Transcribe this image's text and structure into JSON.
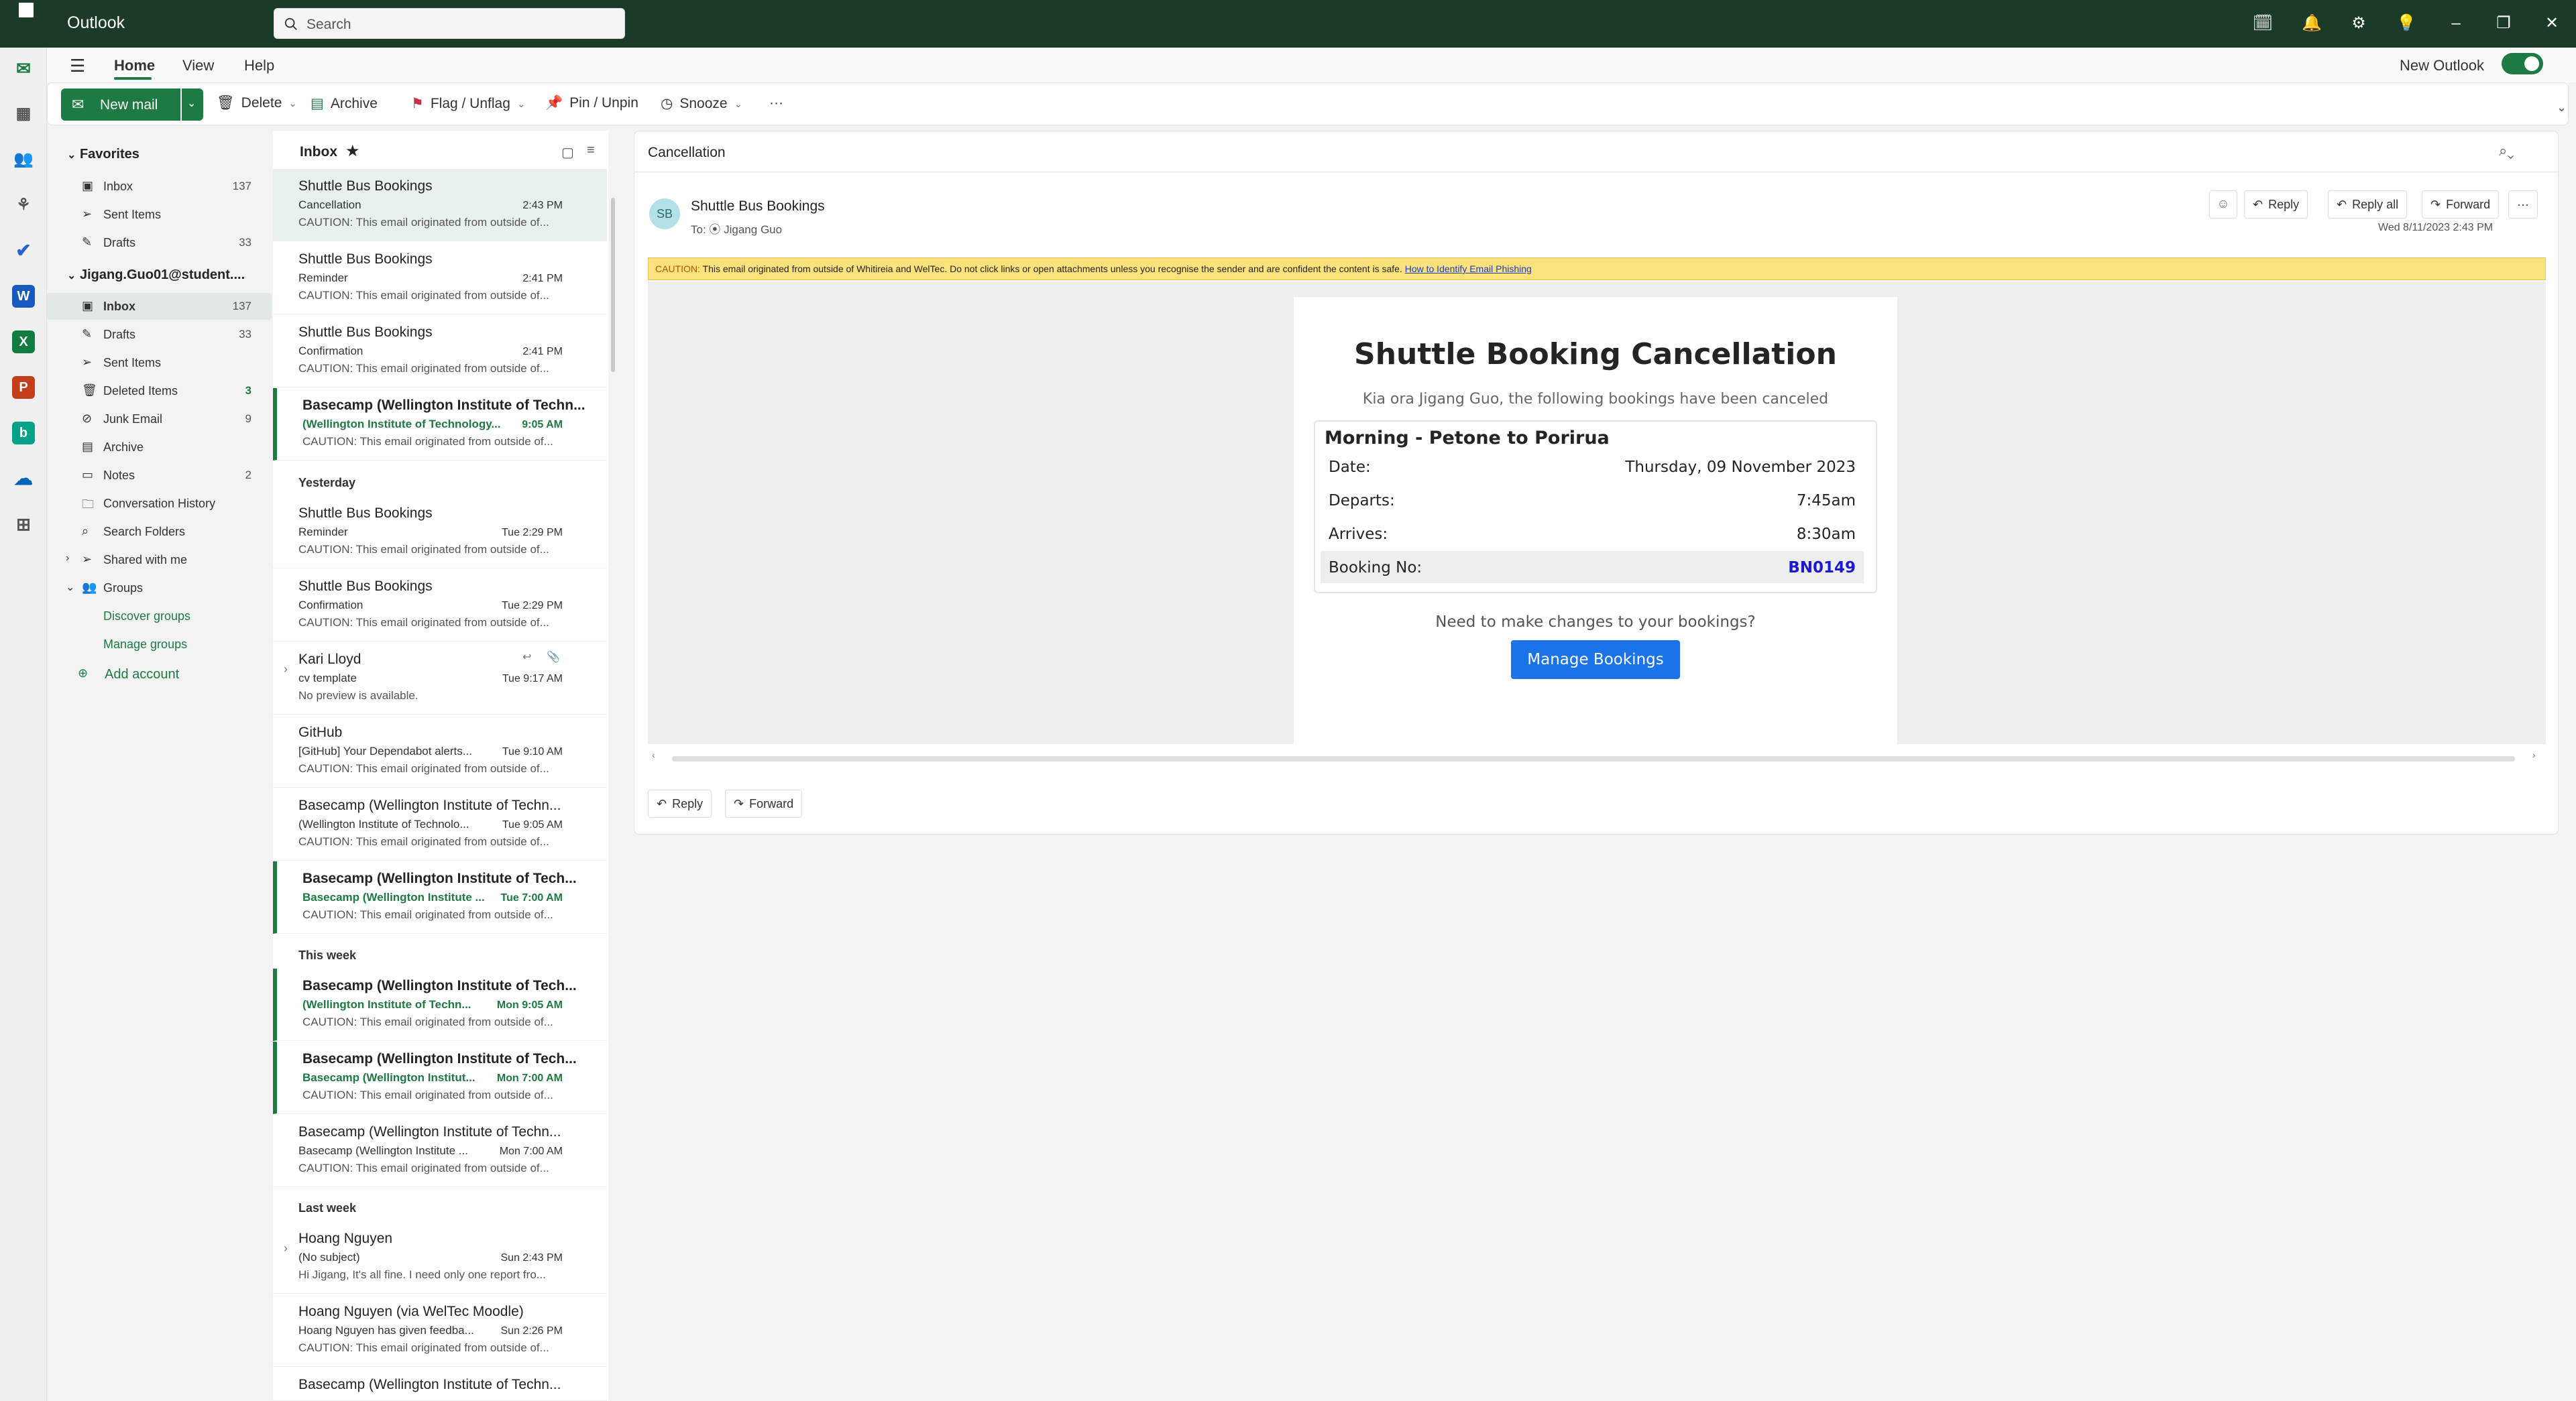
{
  "app": {
    "title": "Outlook",
    "new_outlook_label": "New Outlook"
  },
  "search": {
    "placeholder": "Search"
  },
  "menu": {
    "items": [
      "Home",
      "View",
      "Help"
    ]
  },
  "ribbon": {
    "new_mail": "New mail",
    "delete": "Delete",
    "archive": "Archive",
    "flag": "Flag / Unflag",
    "pin": "Pin / Unpin",
    "snooze": "Snooze",
    "more": "···"
  },
  "folders": {
    "favorites_label": "Favorites",
    "favorites": [
      {
        "name": "Inbox",
        "count": "137"
      },
      {
        "name": "Sent Items",
        "count": ""
      },
      {
        "name": "Drafts",
        "count": "33"
      }
    ],
    "account_label": "Jigang.Guo01@student....",
    "account_items": [
      {
        "name": "Inbox",
        "count": "137"
      },
      {
        "name": "Drafts",
        "count": "33"
      },
      {
        "name": "Sent Items",
        "count": ""
      },
      {
        "name": "Deleted Items",
        "count": "3"
      },
      {
        "name": "Junk Email",
        "count": "9"
      },
      {
        "name": "Archive",
        "count": ""
      },
      {
        "name": "Notes",
        "count": "2"
      },
      {
        "name": "Conversation History",
        "count": ""
      },
      {
        "name": "Search Folders",
        "count": ""
      }
    ],
    "shared_with_me": "Shared with me",
    "groups": "Groups",
    "discover_groups": "Discover groups",
    "manage_groups": "Manage groups",
    "add_account": "Add account"
  },
  "inbox": {
    "title": "Inbox",
    "groups": {
      "yesterday": "Yesterday",
      "this_week": "This week",
      "last_week": "Last week"
    },
    "messages": [
      {
        "sender": "Shuttle Bus Bookings",
        "subject": "Cancellation",
        "time": "2:43 PM",
        "preview": "CAUTION: This email originated from outside of..."
      },
      {
        "sender": "Shuttle Bus Bookings",
        "subject": "Reminder",
        "time": "2:41 PM",
        "preview": "CAUTION: This email originated from outside of..."
      },
      {
        "sender": "Shuttle Bus Bookings",
        "subject": "Confirmation",
        "time": "2:41 PM",
        "preview": "CAUTION: This email originated from outside of..."
      },
      {
        "sender": "Basecamp (Wellington Institute of Techn...",
        "subject": "(Wellington Institute of Technology...",
        "time": "9:05 AM",
        "preview": "CAUTION: This email originated from outside of..."
      },
      {
        "sender": "Shuttle Bus Bookings",
        "subject": "Reminder",
        "time": "Tue 2:29 PM",
        "preview": "CAUTION: This email originated from outside of..."
      },
      {
        "sender": "Shuttle Bus Bookings",
        "subject": "Confirmation",
        "time": "Tue 2:29 PM",
        "preview": "CAUTION: This email originated from outside of..."
      },
      {
        "sender": "Kari Lloyd",
        "subject": "cv template",
        "time": "Tue 9:17 AM",
        "preview": "No preview is available."
      },
      {
        "sender": "GitHub",
        "subject": "[GitHub] Your Dependabot alerts...",
        "time": "Tue 9:10 AM",
        "preview": "CAUTION: This email originated from outside of..."
      },
      {
        "sender": "Basecamp (Wellington Institute of Techn...",
        "subject": "(Wellington Institute of Technolo...",
        "time": "Tue 9:05 AM",
        "preview": "CAUTION: This email originated from outside of..."
      },
      {
        "sender": "Basecamp (Wellington Institute of Tech...",
        "subject": "Basecamp (Wellington Institute ...",
        "time": "Tue 7:00 AM",
        "preview": "CAUTION: This email originated from outside of..."
      },
      {
        "sender": "Basecamp (Wellington Institute of Tech...",
        "subject": "(Wellington Institute of Techn...",
        "time": "Mon 9:05 AM",
        "preview": "CAUTION: This email originated from outside of..."
      },
      {
        "sender": "Basecamp (Wellington Institute of Tech...",
        "subject": "Basecamp (Wellington Institut...",
        "time": "Mon 7:00 AM",
        "preview": "CAUTION: This email originated from outside of..."
      },
      {
        "sender": "Basecamp (Wellington Institute of Techn...",
        "subject": "Basecamp (Wellington Institute ...",
        "time": "Mon 7:00 AM",
        "preview": "CAUTION: This email originated from outside of..."
      },
      {
        "sender": "Hoang Nguyen",
        "subject": "(No subject)",
        "time": "Sun 2:43 PM",
        "preview": "Hi Jigang, It's all fine. I need only one report fro..."
      },
      {
        "sender": "Hoang Nguyen (via WelTec Moodle)",
        "subject": "Hoang Nguyen has given feedba...",
        "time": "Sun 2:26 PM",
        "preview": "CAUTION: This email originated from outside of..."
      },
      {
        "sender": "Basecamp (Wellington Institute of Techn...",
        "subject": "",
        "time": "",
        "preview": ""
      }
    ]
  },
  "reading": {
    "subject": "Cancellation",
    "avatar": "SB",
    "sender": "Shuttle Bus Bookings",
    "to": "To: ⦿ Jigang Guo",
    "date": "Wed 8/11/2023 2:43 PM",
    "reply": "Reply",
    "reply_all": "Reply all",
    "forward": "Forward",
    "caution_prefix": "CAUTION:",
    "caution_text": "This email originated from outside of Whitireia and WelTec. Do not click links or open attachments unless you recognise the sender and are confident the content is safe.",
    "caution_link": "How to Identify Email Phishing",
    "email": {
      "heading": "Shuttle Booking Cancellation",
      "intro": "Kia ora Jigang Guo, the following bookings have been canceled",
      "trip": "Morning - Petone to Porirua",
      "rows": [
        {
          "k": "Date:",
          "v": "Thursday, 09 November 2023"
        },
        {
          "k": "Departs:",
          "v": "7:45am"
        },
        {
          "k": "Arrives:",
          "v": "8:30am"
        },
        {
          "k": "Booking No:",
          "v": "BN0149"
        }
      ],
      "changes": "Need to make changes to your bookings?",
      "manage": "Manage Bookings"
    }
  },
  "colors": {
    "titlebar": "#1c3a28",
    "accent": "#1d7a43",
    "caution_bg": "#fbe27a",
    "manage_btn": "#1a73e8"
  }
}
